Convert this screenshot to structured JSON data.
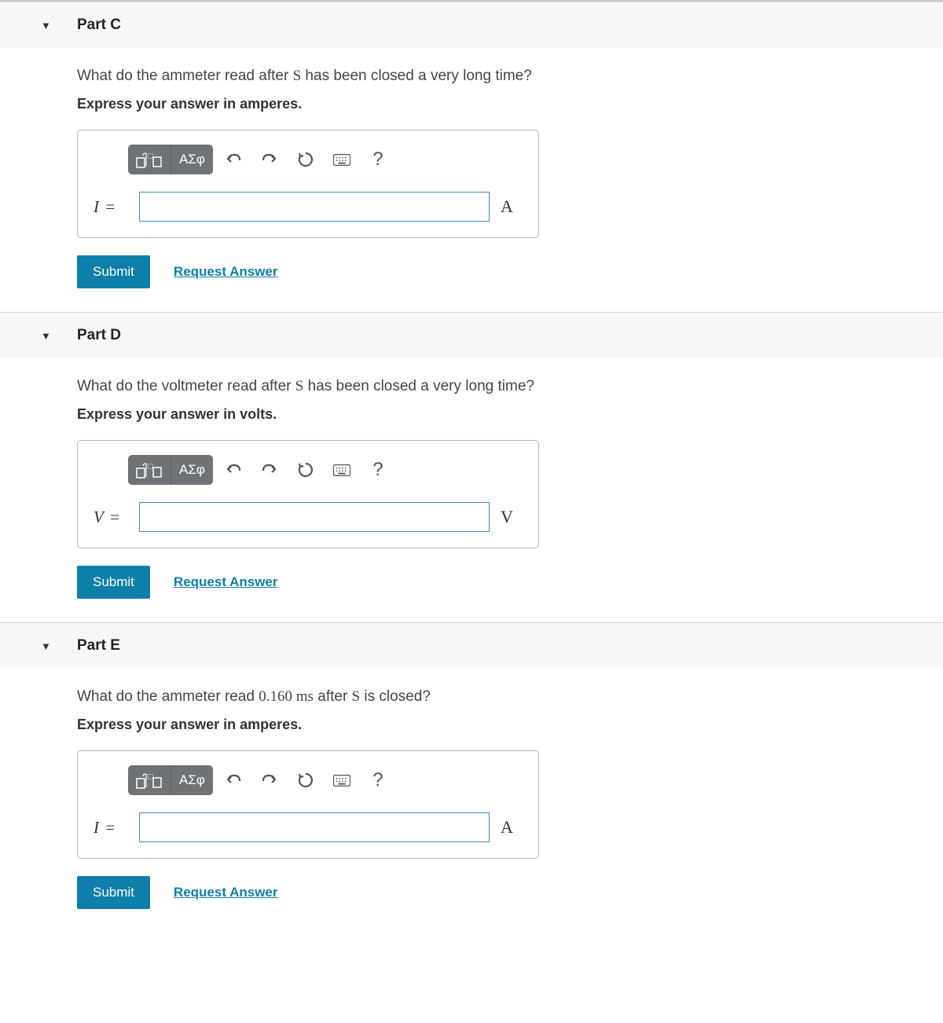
{
  "common": {
    "toolbar": {
      "symbols_label": "ΑΣφ",
      "help": "?"
    },
    "submit": "Submit",
    "request": "Request Answer"
  },
  "parts": {
    "c": {
      "title": "Part C",
      "question_pre": "What do the ammeter read after ",
      "question_sym": "S",
      "question_post": " has been closed a very long time?",
      "instruction": "Express your answer in amperes.",
      "var": "I",
      "eq": " =",
      "unit": "A"
    },
    "d": {
      "title": "Part D",
      "question_pre": "What do the voltmeter read after ",
      "question_sym": "S",
      "question_post": " has been closed a very long time?",
      "instruction": "Express your answer in volts.",
      "var": "V",
      "eq": " =",
      "unit": "V"
    },
    "e": {
      "title": "Part E",
      "question_pre": "What do the ammeter read ",
      "question_mid_val": "0.160",
      "question_mid_unit": " ms",
      "question_mid2": " after ",
      "question_sym": "S",
      "question_post": " is closed?",
      "instruction": "Express your answer in amperes.",
      "var": "I",
      "eq": " =",
      "unit": "A"
    }
  }
}
